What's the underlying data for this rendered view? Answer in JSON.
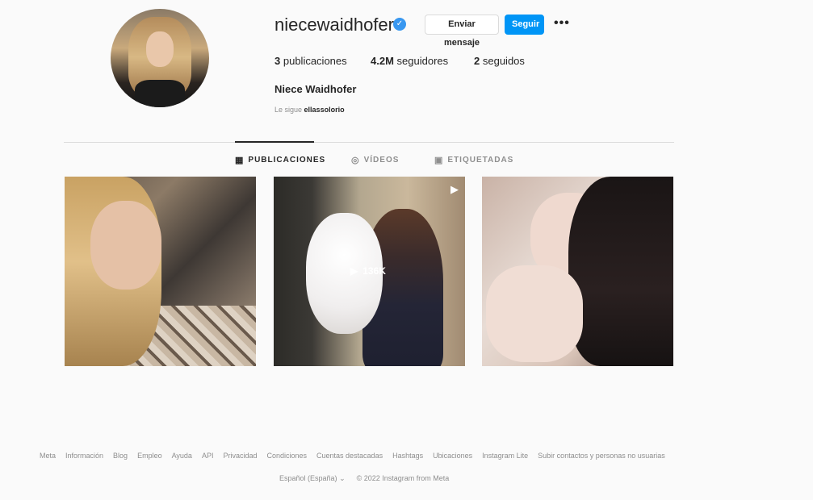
{
  "profile": {
    "username": "niecewaidhofer",
    "verified_icon": "verified-check-icon",
    "message_label": "Enviar mensaje",
    "follow_label": "Seguir",
    "more_label": "•••",
    "posts_count": "3",
    "posts_label": "publicaciones",
    "followers_count": "4.2M",
    "followers_label": "seguidores",
    "following_count": "2",
    "following_label": "seguidos",
    "full_name": "Niece Waidhofer",
    "followed_by_prefix": "Le sigue",
    "followed_by_user": "ellassolorio"
  },
  "tabs": [
    {
      "label": "PUBLICACIONES",
      "icon": "grid-icon"
    },
    {
      "label": "VÍDEOS",
      "icon": "video-icon"
    },
    {
      "label": "ETIQUETADAS",
      "icon": "tag-icon"
    }
  ],
  "posts": [
    {
      "type": "image"
    },
    {
      "type": "video",
      "views": "136K"
    },
    {
      "type": "image"
    }
  ],
  "footer": {
    "links": [
      "Meta",
      "Información",
      "Blog",
      "Empleo",
      "Ayuda",
      "API",
      "Privacidad",
      "Condiciones",
      "Cuentas destacadas",
      "Hashtags",
      "Ubicaciones",
      "Instagram Lite",
      "Subir contactos y personas no usuarias"
    ],
    "language": "Español (España)",
    "copyright": "© 2022 Instagram from Meta"
  },
  "colors": {
    "accent": "#0095f6",
    "verified": "#3897f0"
  }
}
